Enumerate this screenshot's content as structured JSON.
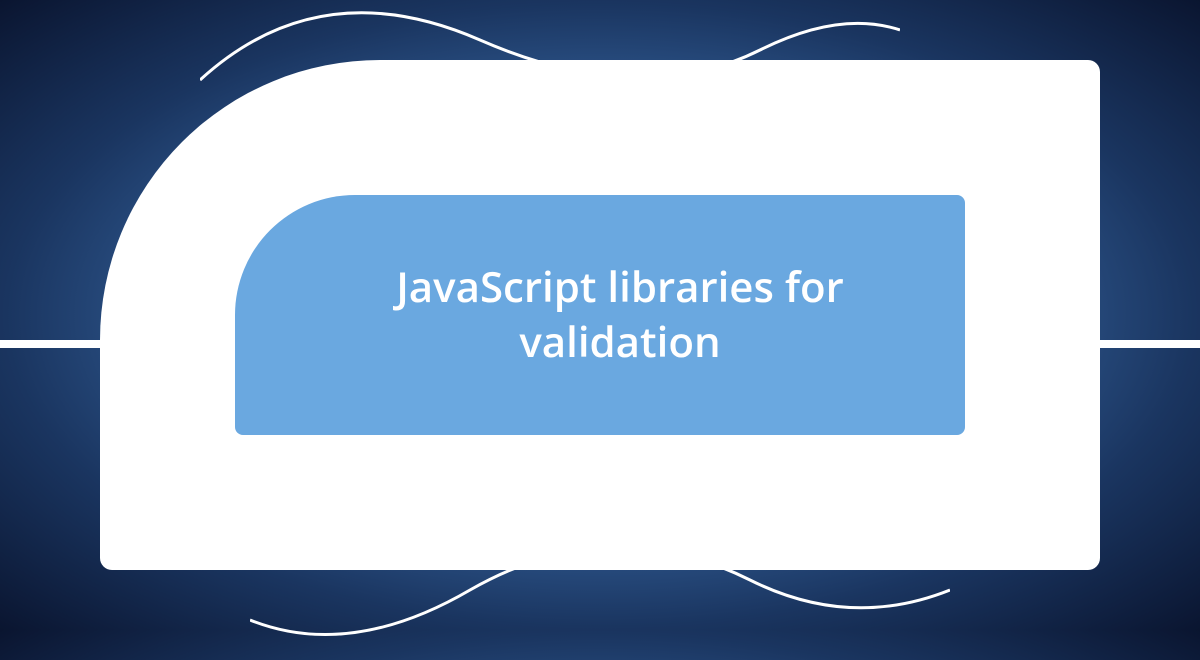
{
  "banner": {
    "title": "JavaScript libraries for validation"
  },
  "colors": {
    "inner_bg": "#6aa8e0",
    "outer_bg": "#ffffff",
    "text": "#ffffff"
  }
}
